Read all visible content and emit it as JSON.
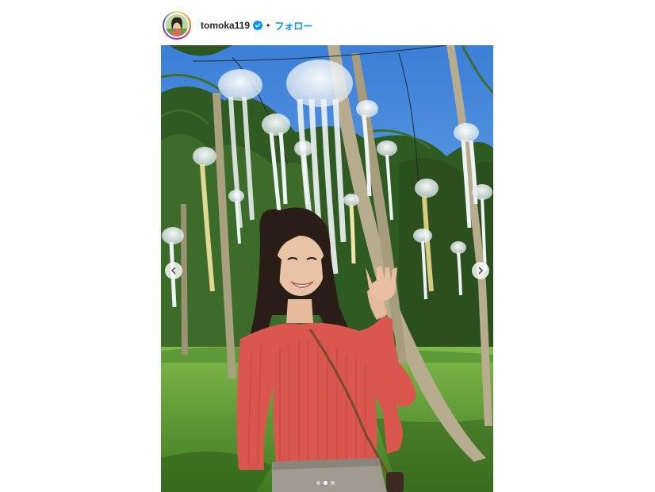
{
  "post": {
    "username": "tomoka119",
    "verified": true,
    "separator": "•",
    "follow_label": "フォロー",
    "carousel": {
      "slide_count": 3,
      "active_index": 1
    }
  },
  "icons": {
    "verified": "verified-badge-icon",
    "prev": "chevron-left-icon",
    "next": "chevron-right-icon"
  },
  "colors": {
    "follow": "#0095f6",
    "verified": "#0095f6",
    "username": "#262626"
  }
}
